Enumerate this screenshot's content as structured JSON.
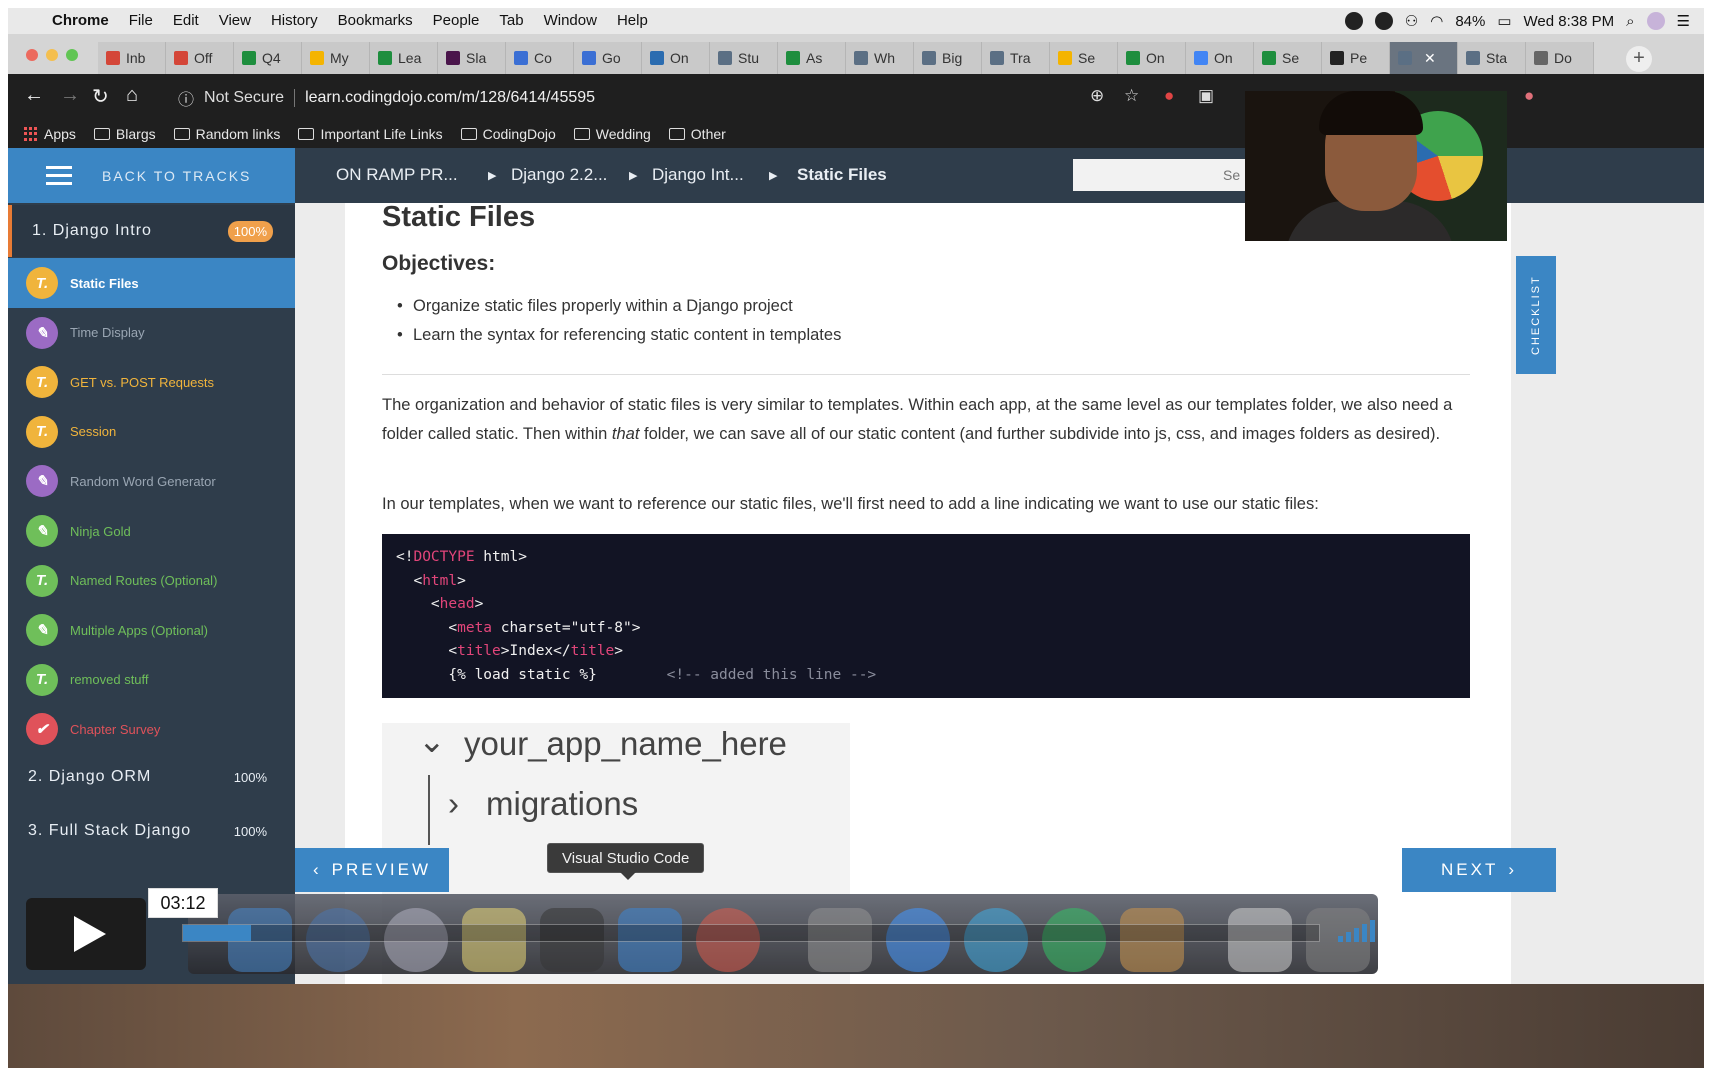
{
  "menubar": {
    "app": "Chrome",
    "items": [
      "File",
      "Edit",
      "View",
      "History",
      "Bookmarks",
      "People",
      "Tab",
      "Window",
      "Help"
    ],
    "battery": "84%",
    "clock": "Wed 8:38 PM"
  },
  "tabs": [
    {
      "label": "Inb",
      "color": "#d44638"
    },
    {
      "label": "Off",
      "color": "#d44638"
    },
    {
      "label": "Q4",
      "color": "#1e8e3e"
    },
    {
      "label": "My",
      "color": "#f4b400"
    },
    {
      "label": "Lea",
      "color": "#1e8e3e"
    },
    {
      "label": "Sla",
      "color": "#4a154b"
    },
    {
      "label": "Co",
      "color": "#3b6fd4"
    },
    {
      "label": "Go",
      "color": "#3b6fd4"
    },
    {
      "label": "On",
      "color": "#2b6cb0"
    },
    {
      "label": "Stu",
      "color": "#5b6f84"
    },
    {
      "label": "As",
      "color": "#1e8e3e"
    },
    {
      "label": "Wh",
      "color": "#5b6f84"
    },
    {
      "label": "Big",
      "color": "#5b6f84"
    },
    {
      "label": "Tra",
      "color": "#5b6f84"
    },
    {
      "label": "Se",
      "color": "#f4b400"
    },
    {
      "label": "On",
      "color": "#1e8e3e"
    },
    {
      "label": "On",
      "color": "#4285f4"
    },
    {
      "label": "Se",
      "color": "#1e8e3e"
    },
    {
      "label": "Pe",
      "color": "#222222"
    },
    {
      "label": "",
      "color": "#5b6f84",
      "active": true
    },
    {
      "label": "Sta",
      "color": "#5b6f84"
    },
    {
      "label": "Do",
      "color": "#666666"
    }
  ],
  "toolbar": {
    "security": "Not Secure",
    "url": "learn.codingdojo.com/m/128/6414/45595"
  },
  "bookmarks": [
    "Apps",
    "Blargs",
    "Random links",
    "Important Life Links",
    "CodingDojo",
    "Wedding",
    "Other"
  ],
  "sidebar": {
    "back": "BACK TO TRACKS",
    "chapters": [
      {
        "label": "1. Django Intro",
        "pct": "100%"
      },
      {
        "label": "2. Django ORM",
        "pct": "100%"
      },
      {
        "label": "3. Full Stack Django",
        "pct": "100%"
      }
    ],
    "lessons": [
      {
        "label": "Static Files",
        "icon": "T.",
        "iconColor": "#f0b43c",
        "textColor": "#ffffff",
        "active": true
      },
      {
        "label": "Time Display",
        "icon": "✎",
        "iconColor": "#9b6bc4",
        "textColor": "#9aa6b3"
      },
      {
        "label": "GET vs. POST Requests",
        "icon": "T.",
        "iconColor": "#f0b43c",
        "textColor": "#f0b43c"
      },
      {
        "label": "Session",
        "icon": "T.",
        "iconColor": "#f0b43c",
        "textColor": "#f0b43c"
      },
      {
        "label": "Random Word Generator",
        "icon": "✎",
        "iconColor": "#9b6bc4",
        "textColor": "#9aa6b3"
      },
      {
        "label": "Ninja Gold",
        "icon": "✎",
        "iconColor": "#6fbf5a",
        "textColor": "#6fbf5a"
      },
      {
        "label": "Named Routes (Optional)",
        "icon": "T.",
        "iconColor": "#6fbf5a",
        "textColor": "#6fbf5a"
      },
      {
        "label": "Multiple Apps (Optional)",
        "icon": "✎",
        "iconColor": "#6fbf5a",
        "textColor": "#6fbf5a"
      },
      {
        "label": "removed stuff",
        "icon": "T.",
        "iconColor": "#6fbf5a",
        "textColor": "#6fbf5a"
      },
      {
        "label": "Chapter Survey",
        "icon": "✔",
        "iconColor": "#e0525a",
        "textColor": "#e0525a"
      }
    ]
  },
  "crumbs": [
    "ON RAMP PR...",
    "Django 2.2...",
    "Django Int...",
    "Static Files"
  ],
  "search": {
    "placeholder": "Se"
  },
  "content": {
    "title": "Static Files",
    "objectives_heading": "Objectives:",
    "objectives": [
      "Organize static files properly within a Django project",
      "Learn the syntax for referencing static content in templates"
    ],
    "para1_a": "The organization and behavior of static files is very similar to templates. Within each app, at the same level as our templates folder, we also need a folder called static. Then within ",
    "para1_em": "that",
    "para1_b": " folder, we can save all of our static content (and further subdivide into js, css, and images folders as desired).",
    "para2": "In our templates, when we want to reference our static files, we'll first need to add a line indicating we want to use our static files:",
    "code": {
      "l1_kw": "DOCTYPE",
      "l1_rest": " html>",
      "l2_kw": "html",
      "l3_kw": "head",
      "l4_kw": "meta",
      "l4_rest": " charset=\"utf-8\">",
      "l5_kw": "title",
      "l5_text": "Index",
      "l6_tag": "{% load static %}",
      "l6_comment": "<!-- added this line -->"
    },
    "tree": {
      "folder": "your_app_name_here",
      "sub": "migrations"
    }
  },
  "checklist": "CHECKLIST",
  "nav": {
    "prev": "PREVIEW",
    "next": "NEXT"
  },
  "player": {
    "time": "03:12",
    "tooltip": "Visual Studio Code",
    "progress": 0.06
  }
}
